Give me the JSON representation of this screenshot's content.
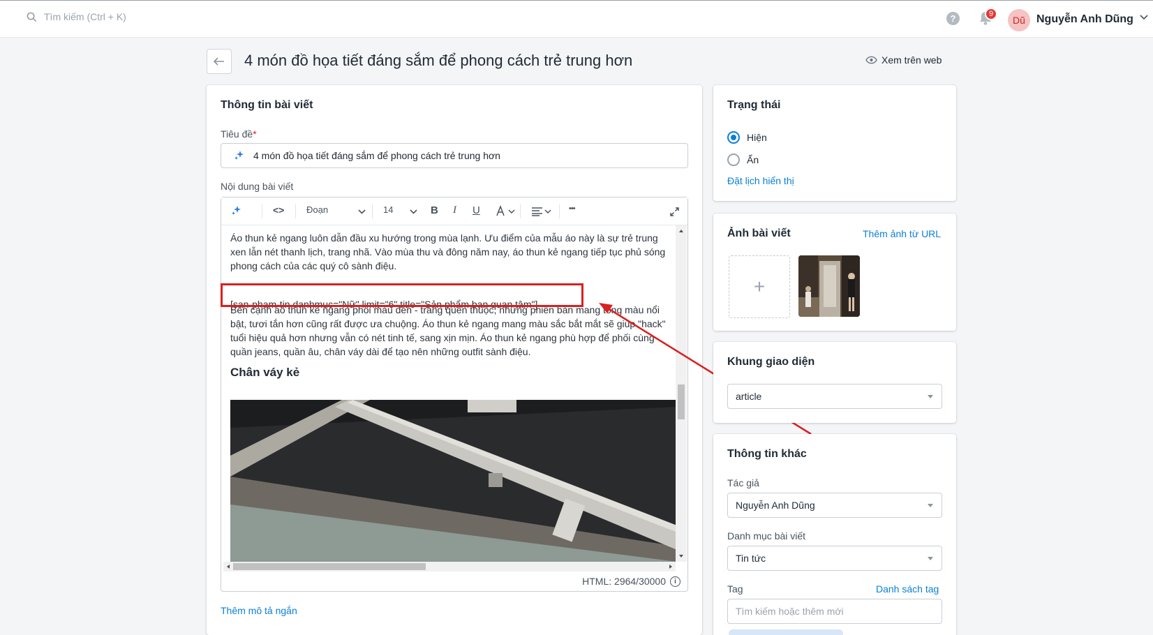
{
  "topbar": {
    "search_placeholder": "Tìm kiếm (Ctrl + K)",
    "help_label": "?",
    "notification_count": "9",
    "avatar_initials": "Dũ",
    "user_name": "Nguyễn Anh Dũng"
  },
  "header": {
    "title": "4 món đồ họa tiết đáng sắm để phong cách trẻ trung hơn",
    "view_on_web": "Xem trên web"
  },
  "article_card": {
    "title": "Thông tin bài viết",
    "title_label": "Tiêu đề",
    "required_mark": "*",
    "title_value": "4 món đồ họa tiết đáng sắm để phong cách trẻ trung hơn",
    "content_label": "Nội dung bài viết",
    "toolbar": {
      "code_label": "<>",
      "paragraph": "Đoạn",
      "font_size": "14",
      "bold": "B",
      "italic": "I",
      "underline": "U",
      "more": "•••"
    },
    "paragraph1": "Áo thun kẻ ngang luôn dẫn đầu xu hướng trong mùa lạnh. Ưu điểm của mẫu áo này là sự trẻ trung xen lẫn nét thanh lịch, trang nhã. Vào mùa thu và đông năm nay, áo thun kẻ ngang tiếp tục phủ sóng phong cách của các quý cô sành điệu.",
    "shortcode": "[san-pham-tin danhmuc=\"Nữ\" limit=\"6\" title=\"Sản phẩm bạn quan tâm\"]",
    "paragraph2": "Bên cạnh áo thun kẻ ngang phối màu đen - trắng quen thuộc, những phiên bản mang tông màu nổi bật, tươi tắn hơn cũng rất được ưa chuộng. Áo thun kẻ ngang mang màu sắc bắt mắt sẽ giúp \"hack\" tuổi hiệu quả hơn nhưng vẫn có nét tinh tế, sang xịn mịn. Áo thun kẻ ngang phù hợp để phối cùng quần jeans, quần âu, chân váy dài để tạo nên những outfit sành điệu.",
    "heading": "Chân váy kẻ",
    "html_count": "HTML: 2964/30000",
    "add_short_desc": "Thêm mô tả ngắn"
  },
  "status_card": {
    "title": "Trạng thái",
    "option_show": "Hiện",
    "option_hide": "Ẩn",
    "selected": "Hiện",
    "schedule_link": "Đặt lịch hiển thị"
  },
  "image_card": {
    "title": "Ảnh bài viết",
    "add_from_url": "Thêm ảnh từ URL",
    "add_symbol": "+"
  },
  "template_card": {
    "title": "Khung giao diện",
    "value": "article"
  },
  "other_card": {
    "title": "Thông tin khác",
    "author_label": "Tác giả",
    "author_value": "Nguyễn Anh Dũng",
    "category_label": "Danh mục bài viết",
    "category_value": "Tin tức",
    "tag_label": "Tag",
    "tag_list_link": "Danh sách tag",
    "tag_placeholder": "Tìm kiếm hoặc thêm mới"
  },
  "colors": {
    "accent": "#0a7fd8",
    "annotation_red": "#d9201f",
    "badge_red": "#e53935"
  }
}
